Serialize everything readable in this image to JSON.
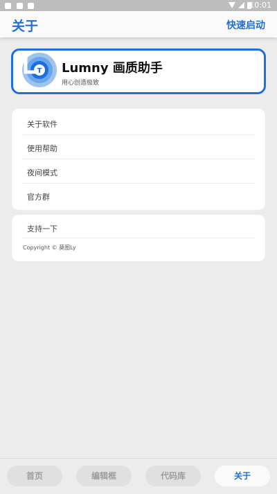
{
  "status_bar": {
    "time": "10:01",
    "left_icons": [
      "notification-icon",
      "mail-icon",
      "app-icon"
    ],
    "right_icons": [
      "wifi-icon",
      "signal-icon",
      "battery-icon"
    ]
  },
  "appbar": {
    "title": "关于",
    "action": "快速启动"
  },
  "hero": {
    "title": "Lumny 画质助手",
    "subtitle": "用心创造极致",
    "logo_letter": "T",
    "accent": "#1d6fe0"
  },
  "menu": {
    "items": [
      {
        "label": "关于软件"
      },
      {
        "label": "使用帮助"
      },
      {
        "label": "夜间模式"
      },
      {
        "label": "官方群"
      }
    ]
  },
  "support": {
    "label": "支持一下",
    "copyright": "Copyright © 莫图Ly"
  },
  "bottom_nav": {
    "tabs": [
      {
        "label": "首页"
      },
      {
        "label": "编辑框"
      },
      {
        "label": "代码库"
      },
      {
        "label": "关于"
      }
    ],
    "active": "关于"
  },
  "colors": {
    "accent": "#1e6fd6",
    "background": "#ececec",
    "card": "#ffffff"
  }
}
